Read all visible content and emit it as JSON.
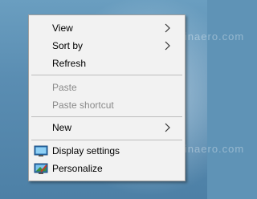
{
  "context_menu": {
    "view_label": "View",
    "sort_by_label": "Sort by",
    "refresh_label": "Refresh",
    "paste_label": "Paste",
    "paste_shortcut_label": "Paste shortcut",
    "new_label": "New",
    "display_settings_label": "Display settings",
    "personalize_label": "Personalize",
    "disabled_text_color": "#8a8a8a",
    "menu_background": "#f2f2f2"
  },
  "watermark_text": "http://winaero.com",
  "icons": {
    "view_submenu": "chevron-right-icon",
    "sort_by_submenu": "chevron-right-icon",
    "new_submenu": "chevron-right-icon",
    "display_settings": "monitor-icon",
    "personalize": "personalize-icon"
  }
}
